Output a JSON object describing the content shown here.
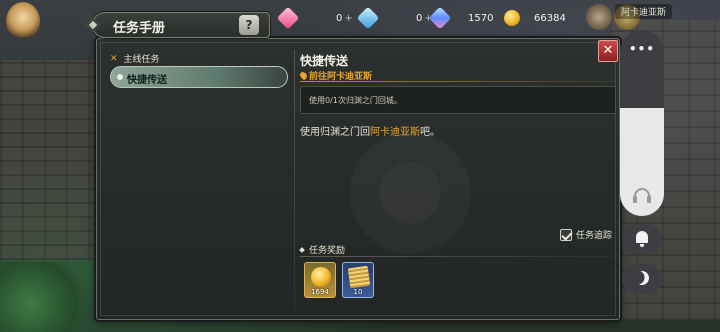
{
  "resources": {
    "pink_gem_value": "0",
    "blue_gem_value": "0",
    "multi_gem_value": "1570",
    "gold_value": "66384",
    "plus_symbol": "+"
  },
  "background": {
    "top_right_label": "阿卡迪亚斯"
  },
  "panel": {
    "title": "任务手册",
    "help_symbol": "?",
    "close_symbol": "✕"
  },
  "categories": {
    "header": "主线任务",
    "items": [
      {
        "label": "快捷传送"
      }
    ]
  },
  "quest": {
    "title": "快捷传送",
    "goto_label": "前往阿卡迪亚斯",
    "objective": "使用0/1次归渊之门回城。",
    "description_prefix": "使用归渊之门回",
    "description_highlight": "阿卡迪亚斯",
    "description_suffix": "吧。",
    "track_label": "任务追踪",
    "track_checked": true
  },
  "rewards": {
    "header": "任务奖励",
    "items": [
      {
        "name": "gold-coin",
        "qty": "1694"
      },
      {
        "name": "scroll",
        "qty": "10"
      }
    ]
  },
  "overlay": {
    "menu_dots": "•••"
  },
  "colors": {
    "accent_gold": "#e5a531",
    "close_red": "#b53434",
    "panel_bg": "#262a28"
  }
}
